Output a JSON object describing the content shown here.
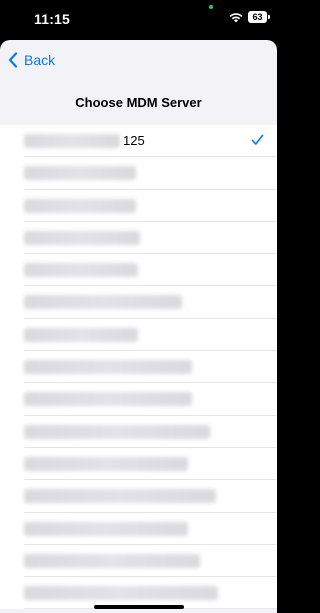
{
  "status_bar": {
    "time": "11:15",
    "battery": "63",
    "privacy_dot_color": "#34c759"
  },
  "nav": {
    "back_label": "Back",
    "title": "Choose MDM Server"
  },
  "accent_color": "#007aff",
  "servers": {
    "selected_index": 0,
    "items": [
      {
        "visible_text": "125",
        "selected": true
      },
      {
        "visible_text": "",
        "selected": false
      },
      {
        "visible_text": "",
        "selected": false
      },
      {
        "visible_text": "",
        "selected": false
      },
      {
        "visible_text": "",
        "selected": false
      },
      {
        "visible_text": "",
        "selected": false
      },
      {
        "visible_text": "",
        "selected": false
      },
      {
        "visible_text": "",
        "selected": false
      },
      {
        "visible_text": "",
        "selected": false
      },
      {
        "visible_text": "",
        "selected": false
      },
      {
        "visible_text": "",
        "selected": false
      },
      {
        "visible_text": "",
        "selected": false
      },
      {
        "visible_text": "",
        "selected": false
      },
      {
        "visible_text": "",
        "selected": false
      },
      {
        "visible_text": "",
        "selected": false
      }
    ]
  }
}
